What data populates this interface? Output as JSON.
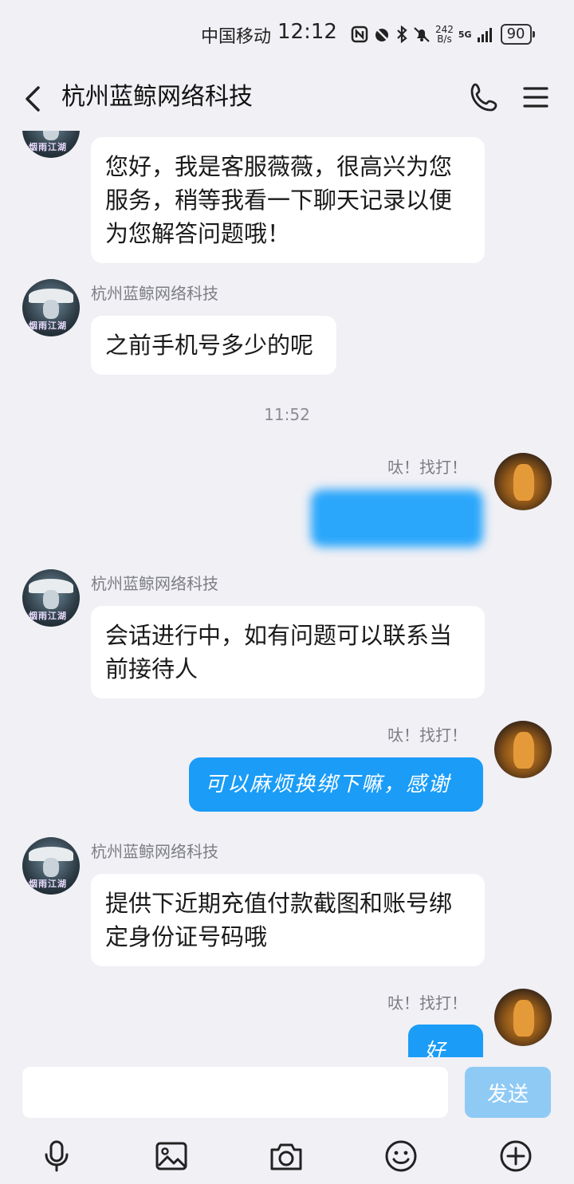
{
  "status_bar": {
    "carrier": "中国移动",
    "time": "12:12",
    "net_speed_value": "242",
    "net_speed_unit": "B/s",
    "network": "5G",
    "battery": "90"
  },
  "header": {
    "title": "杭州蓝鲸网络科技"
  },
  "avatars": {
    "agent_text": "烟雨江湖"
  },
  "messages": {
    "m1": {
      "text": "您好，我是客服薇薇，很高兴为您服务，稍等我看一下聊天记录以便为您解答问题哦！"
    },
    "m2": {
      "sender": "杭州蓝鲸网络科技",
      "text": "之前手机号多少的呢"
    },
    "time1": "11:52",
    "m3": {
      "sender": "呔！找打！"
    },
    "m4": {
      "sender": "杭州蓝鲸网络科技",
      "text": "会话进行中，如有问题可以联系当前接待人"
    },
    "m5": {
      "sender": "呔！找打！",
      "text": "可以麻烦换绑下嘛，感谢"
    },
    "m6": {
      "sender": "杭州蓝鲸网络科技",
      "text": "提供下近期充值付款截图和账号绑定身份证号码哦"
    },
    "m7": {
      "sender": "呔！找打！",
      "text": "好的"
    }
  },
  "input": {
    "value": "",
    "send_label": "发送"
  },
  "toolbar": {
    "icons": [
      "microphone-icon",
      "image-icon",
      "camera-icon",
      "emoji-icon",
      "plus-icon"
    ]
  },
  "colors": {
    "background": "#f0f0f5",
    "outgoing_bubble": "#1a9cf7",
    "incoming_bubble": "#ffffff",
    "send_button": "#8fcaf5"
  }
}
